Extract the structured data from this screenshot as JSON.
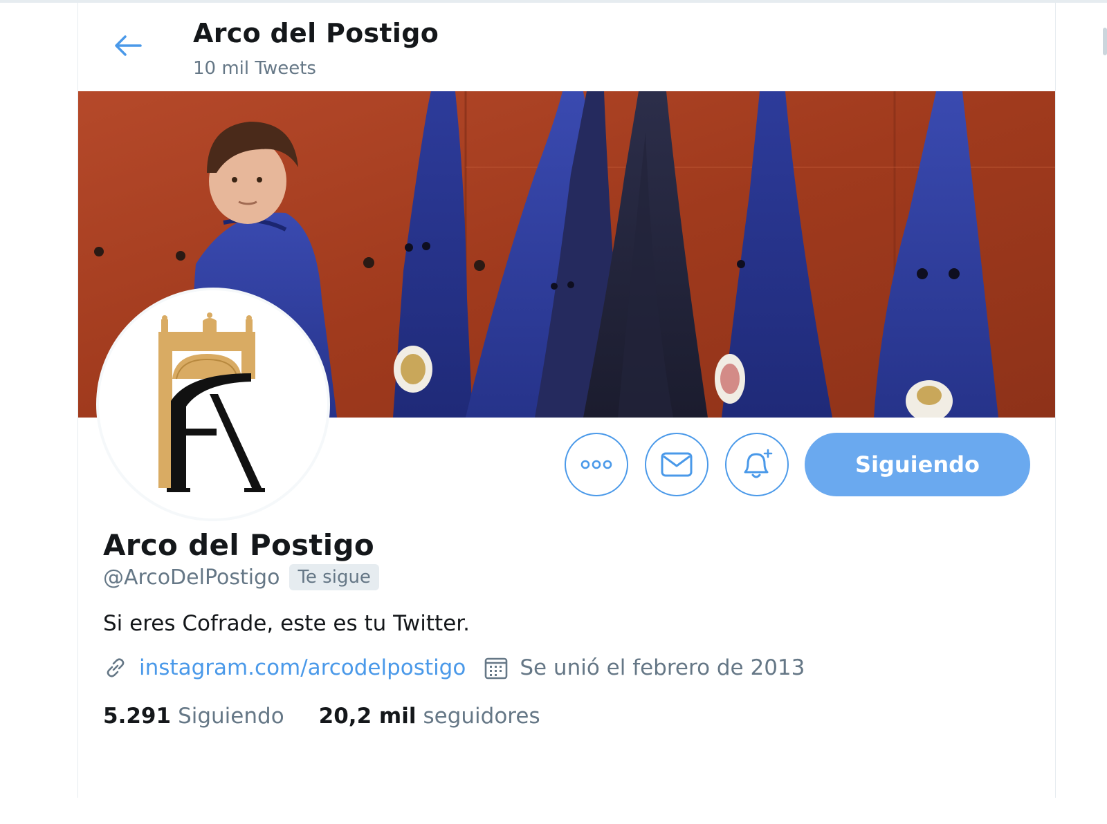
{
  "header": {
    "title": "Arco del Postigo",
    "tweet_count": "10 mil Tweets"
  },
  "icons": {
    "back": "arrow-left-icon",
    "more": "more-icon",
    "message": "envelope-icon",
    "notify": "bell-plus-icon",
    "link": "link-icon",
    "calendar": "calendar-icon"
  },
  "actions": {
    "follow_label": "Siguiendo"
  },
  "profile": {
    "name": "Arco del Postigo",
    "handle": "@ArcoDelPostigo",
    "follows_you": "Te sigue",
    "bio": "Si eres Cofrade, este es tu Twitter.",
    "website": "instagram.com/arcodelpostigo",
    "joined": "Se unió el febrero de 2013"
  },
  "stats": {
    "following_count": "5.291",
    "following_label": "Siguiendo",
    "followers_count": "20,2 mil",
    "followers_label": "seguidores"
  },
  "colors": {
    "accent": "#4a99e9",
    "follow_button": "#6aa9ef",
    "muted_text": "#657786",
    "banner_wall": "#a23d1e"
  }
}
